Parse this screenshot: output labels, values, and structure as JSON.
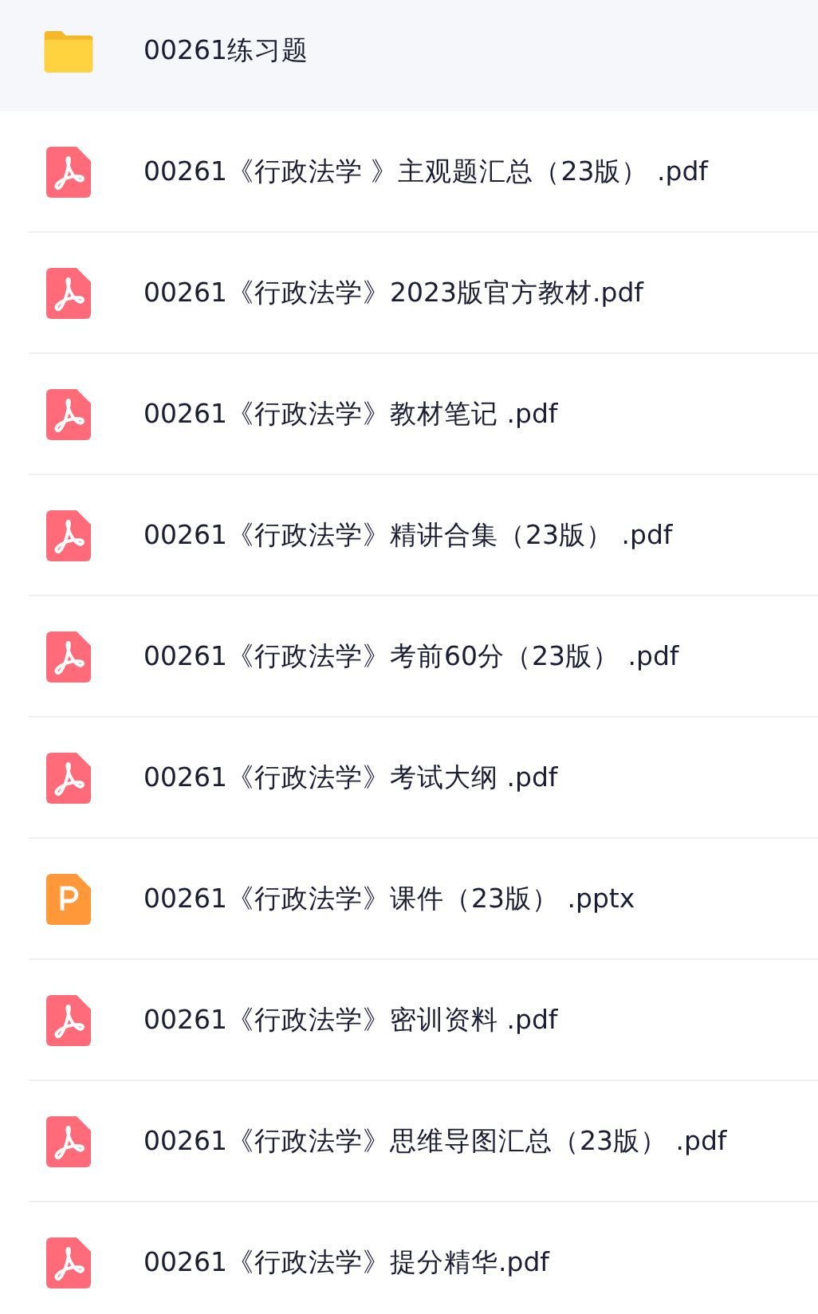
{
  "files": [
    {
      "kind": "folder",
      "name": "00261练习题",
      "selected": true
    },
    {
      "kind": "pdf",
      "name": "00261《行政法学 》主观题汇总（23版） .pdf",
      "selected": false
    },
    {
      "kind": "pdf",
      "name": "00261《行政法学》2023版官方教材.pdf",
      "selected": false
    },
    {
      "kind": "pdf",
      "name": "00261《行政法学》教材笔记 .pdf",
      "selected": false
    },
    {
      "kind": "pdf",
      "name": "00261《行政法学》精讲合集（23版） .pdf",
      "selected": false
    },
    {
      "kind": "pdf",
      "name": "00261《行政法学》考前60分（23版） .pdf",
      "selected": false
    },
    {
      "kind": "pdf",
      "name": "00261《行政法学》考试大纲 .pdf",
      "selected": false
    },
    {
      "kind": "pptx",
      "name": "00261《行政法学》课件（23版） .pptx",
      "selected": false
    },
    {
      "kind": "pdf",
      "name": "00261《行政法学》密训资料 .pdf",
      "selected": false
    },
    {
      "kind": "pdf",
      "name": "00261《行政法学》思维导图汇总（23版） .pdf",
      "selected": false
    },
    {
      "kind": "pdf",
      "name": "00261《行政法学》提分精华.pdf",
      "selected": false
    }
  ]
}
